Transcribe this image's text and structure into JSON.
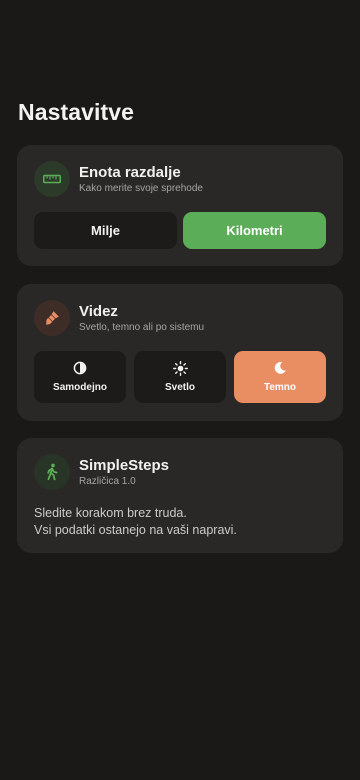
{
  "page": {
    "title": "Nastavitve"
  },
  "distance": {
    "icon": "ruler-icon",
    "title": "Enota razdalje",
    "subtitle": "Kako merite svoje sprehode",
    "options": {
      "miles": "Milje",
      "km": "Kilometri"
    },
    "selected": "Kilometri",
    "accent_color": "#5cad58"
  },
  "theme": {
    "icon": "paintbrush-icon",
    "title": "Videz",
    "subtitle": "Svetlo, temno ali po sistemu",
    "options": {
      "auto": "Samodejno",
      "light": "Svetlo",
      "dark": "Temno"
    },
    "selected": "Temno",
    "accent_color": "#e98d63"
  },
  "about": {
    "icon": "walking-person-icon",
    "app_name": "SimpleSteps",
    "version": "Različica 1.0",
    "description_line1": "Sledite korakom brez truda.",
    "description_line2": "Vsi podatki ostanejo na vaši napravi.",
    "accent_color": "#5cad58"
  }
}
